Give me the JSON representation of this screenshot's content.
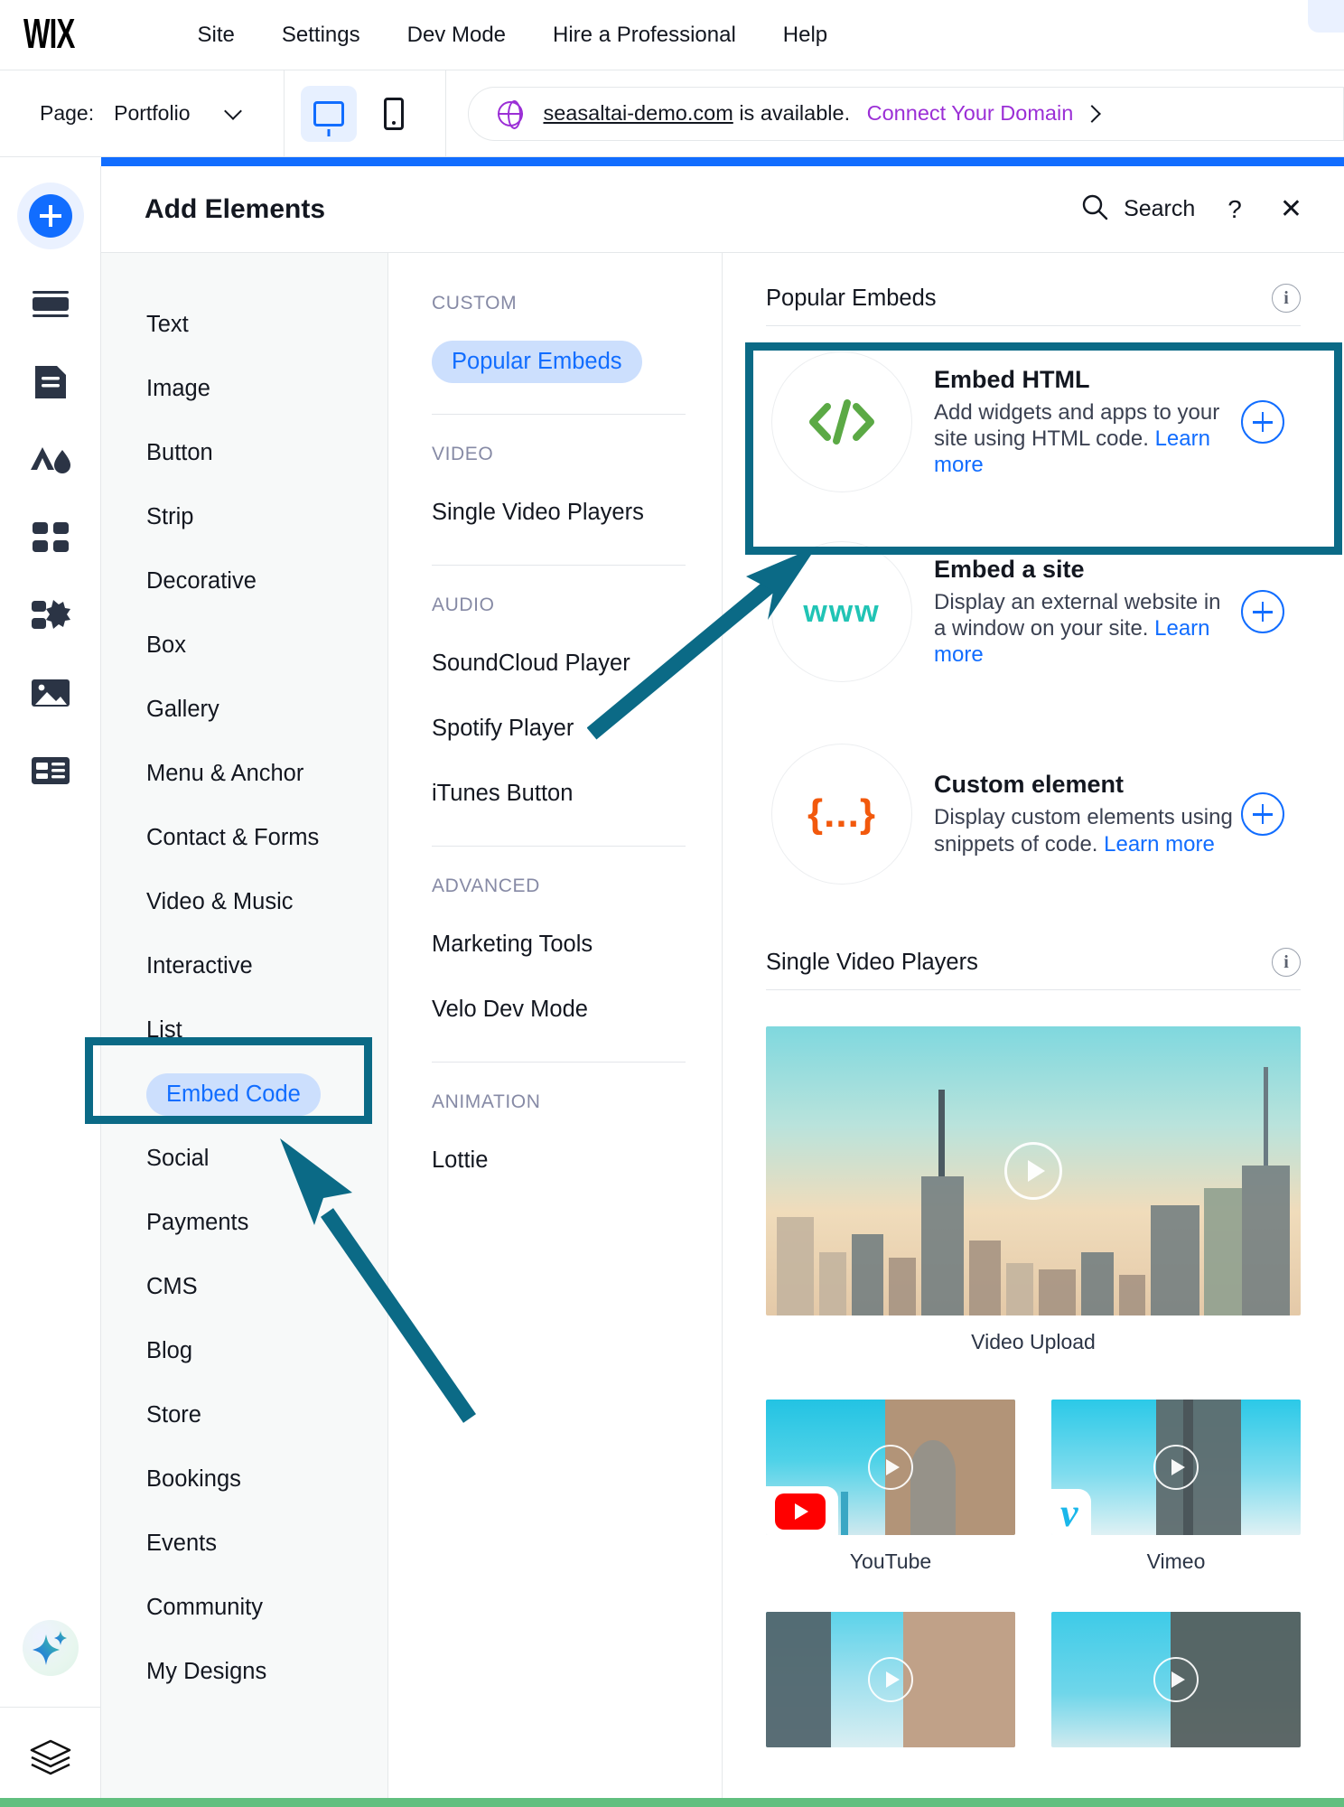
{
  "app": {
    "logo": "WIX"
  },
  "topmenu": [
    {
      "label": "Site"
    },
    {
      "label": "Settings"
    },
    {
      "label": "Dev Mode"
    },
    {
      "label": "Hire a Professional"
    },
    {
      "label": "Help"
    }
  ],
  "secondbar": {
    "page_label": "Page:",
    "page_value": "Portfolio",
    "desktop_view": "desktop-view",
    "mobile_view": "mobile-view",
    "domain_name": "seasaltai-demo.com",
    "domain_status": "is available.",
    "connect_label": "Connect Your Domain"
  },
  "panel": {
    "title": "Add Elements",
    "search_label": "Search",
    "help_label": "?",
    "close_label": "✕"
  },
  "categories": [
    {
      "label": "Text",
      "selected": false
    },
    {
      "label": "Image",
      "selected": false
    },
    {
      "label": "Button",
      "selected": false
    },
    {
      "label": "Strip",
      "selected": false
    },
    {
      "label": "Decorative",
      "selected": false
    },
    {
      "label": "Box",
      "selected": false
    },
    {
      "label": "Gallery",
      "selected": false
    },
    {
      "label": "Menu & Anchor",
      "selected": false
    },
    {
      "label": "Contact & Forms",
      "selected": false
    },
    {
      "label": "Video & Music",
      "selected": false
    },
    {
      "label": "Interactive",
      "selected": false
    },
    {
      "label": "List",
      "selected": false
    },
    {
      "label": "Embed Code",
      "selected": true
    },
    {
      "label": "Social",
      "selected": false
    },
    {
      "label": "Payments",
      "selected": false
    },
    {
      "label": "CMS",
      "selected": false
    },
    {
      "label": "Blog",
      "selected": false
    },
    {
      "label": "Store",
      "selected": false
    },
    {
      "label": "Bookings",
      "selected": false
    },
    {
      "label": "Events",
      "selected": false
    },
    {
      "label": "Community",
      "selected": false
    },
    {
      "label": "My Designs",
      "selected": false
    }
  ],
  "subgroups": [
    {
      "heading": "CUSTOM",
      "items": [
        {
          "label": "Popular Embeds",
          "selected": true
        }
      ]
    },
    {
      "heading": "VIDEO",
      "items": [
        {
          "label": "Single Video Players",
          "selected": false
        }
      ]
    },
    {
      "heading": "AUDIO",
      "items": [
        {
          "label": "SoundCloud Player",
          "selected": false
        },
        {
          "label": "Spotify Player",
          "selected": false
        },
        {
          "label": "iTunes Button",
          "selected": false
        }
      ]
    },
    {
      "heading": "ADVANCED",
      "items": [
        {
          "label": "Marketing Tools",
          "selected": false
        },
        {
          "label": "Velo Dev Mode",
          "selected": false
        }
      ]
    },
    {
      "heading": "ANIMATION",
      "items": [
        {
          "label": "Lottie",
          "selected": false
        }
      ]
    }
  ],
  "popular_embeds": {
    "section_title": "Popular Embeds",
    "cards": [
      {
        "title": "Embed HTML",
        "desc": "Add widgets and apps to your site using HTML code.",
        "learn_more": "Learn more",
        "icon": "code-brackets-icon",
        "icon_glyph": "</>",
        "highlighted": true
      },
      {
        "title": "Embed a site",
        "desc": "Display an external website in a window on your site.",
        "learn_more": "Learn more",
        "icon": "www-icon",
        "icon_glyph": "www",
        "highlighted": false
      },
      {
        "title": "Custom element",
        "desc": "Display custom elements using snippets of code.",
        "learn_more": "Learn more",
        "icon": "curly-braces-icon",
        "icon_glyph": "{...}",
        "highlighted": false
      }
    ]
  },
  "single_video_players": {
    "section_title": "Single Video Players",
    "featured": {
      "caption": "Video Upload"
    },
    "grid": [
      {
        "caption": "YouTube",
        "badge": "youtube-logo"
      },
      {
        "caption": "Vimeo",
        "badge": "vimeo-logo"
      }
    ]
  },
  "rail_icons": [
    {
      "name": "add-elements-icon"
    },
    {
      "name": "sections-icon"
    },
    {
      "name": "pages-icon"
    },
    {
      "name": "theme-icon"
    },
    {
      "name": "apps-icon"
    },
    {
      "name": "my-business-icon"
    },
    {
      "name": "media-icon"
    },
    {
      "name": "cms-icon"
    },
    {
      "name": "ai-assistant-icon"
    },
    {
      "name": "layers-icon"
    }
  ],
  "colors": {
    "accent_blue": "#116dff",
    "highlight_teal": "#0b6a86",
    "pill_bg": "#ccdffd",
    "domain_purple": "#9b2fd6",
    "code_green": "#5ba945",
    "www_teal": "#21c4b5",
    "braces_orange": "#f2590d",
    "bottom_green": "#61bf7f"
  }
}
